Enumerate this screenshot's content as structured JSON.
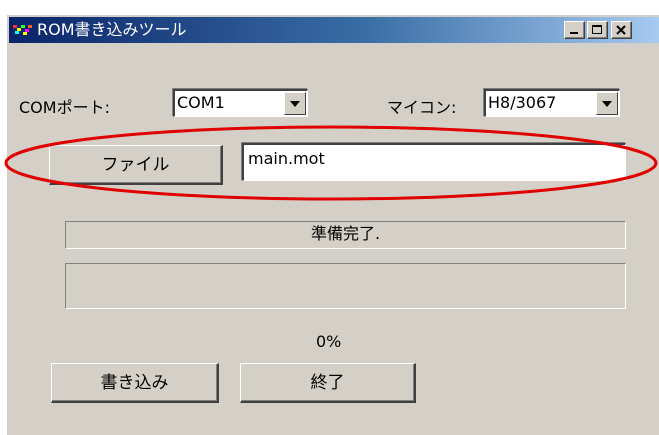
{
  "window": {
    "title": "ROM書き込みツール",
    "icons": {
      "app": "app-icon",
      "minimize": "minimize-icon",
      "maximize": "maximize-icon",
      "close": "close-icon"
    }
  },
  "com_port": {
    "label": "COMポート:",
    "value": "COM1"
  },
  "mcu": {
    "label": "マイコン:",
    "value": "H8/3067"
  },
  "file": {
    "button_label": "ファイル",
    "path": "main.mot"
  },
  "status": {
    "text": "準備完了."
  },
  "progress": {
    "value": 0,
    "text": "0%"
  },
  "actions": {
    "write_label": "書き込み",
    "exit_label": "終了"
  },
  "colors": {
    "highlight": "#e00000",
    "progress": "#0a246a",
    "titlebar": "#0a246a",
    "face": "#d4d0c8"
  }
}
